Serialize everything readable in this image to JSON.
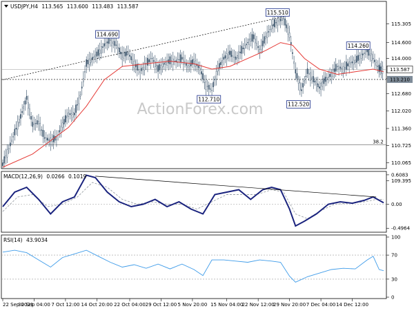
{
  "chart_data": {
    "type": "line",
    "symbol_header": "USDJPY,H4",
    "ohlc": [
      "113.565",
      "113.600",
      "113.483",
      "113.587"
    ],
    "watermark": "ActionForex.com",
    "price_axis": {
      "range": [
        109.9,
        116.1
      ],
      "ticks": [
        "115.305",
        "114.600",
        "114.000",
        "113.240",
        "112.680",
        "112.020",
        "111.360",
        "110.725",
        "110.065",
        "109.395"
      ]
    },
    "current_price": "113.587",
    "support_level": "113.210",
    "fib_label": "38.2",
    "fib_level": 110.75,
    "annotations": [
      {
        "label": "114.690",
        "x": 70,
        "y": 114.69
      },
      {
        "label": "115.510",
        "x": 184,
        "y": 115.51
      },
      {
        "label": "112.710",
        "x": 138,
        "y": 112.71
      },
      {
        "label": "112.520",
        "x": 198,
        "y": 112.52
      },
      {
        "label": "114.260",
        "x": 238,
        "y": 114.26
      }
    ],
    "price_series": [
      [
        0,
        110.0
      ],
      [
        4,
        110.6
      ],
      [
        8,
        111.2
      ],
      [
        12,
        111.8
      ],
      [
        16,
        112.5
      ],
      [
        20,
        111.5
      ],
      [
        24,
        111.6
      ],
      [
        28,
        111.0
      ],
      [
        32,
        110.9
      ],
      [
        36,
        111.0
      ],
      [
        40,
        111.5
      ],
      [
        44,
        111.9
      ],
      [
        48,
        111.9
      ],
      [
        52,
        112.6
      ],
      [
        56,
        113.8
      ],
      [
        60,
        114.0
      ],
      [
        64,
        114.2
      ],
      [
        68,
        114.5
      ],
      [
        72,
        114.7
      ],
      [
        76,
        114.5
      ],
      [
        80,
        114.1
      ],
      [
        84,
        114.2
      ],
      [
        88,
        113.8
      ],
      [
        92,
        113.5
      ],
      [
        96,
        113.8
      ],
      [
        100,
        114.0
      ],
      [
        104,
        113.6
      ],
      [
        108,
        113.8
      ],
      [
        112,
        113.9
      ],
      [
        116,
        113.9
      ],
      [
        120,
        114.0
      ],
      [
        124,
        113.7
      ],
      [
        128,
        113.9
      ],
      [
        132,
        113.6
      ],
      [
        136,
        113.0
      ],
      [
        140,
        112.8
      ],
      [
        144,
        113.6
      ],
      [
        148,
        114.0
      ],
      [
        152,
        114.2
      ],
      [
        156,
        114.0
      ],
      [
        160,
        114.3
      ],
      [
        164,
        114.6
      ],
      [
        168,
        114.8
      ],
      [
        172,
        114.3
      ],
      [
        176,
        114.8
      ],
      [
        180,
        115.2
      ],
      [
        184,
        115.4
      ],
      [
        188,
        115.5
      ],
      [
        192,
        114.9
      ],
      [
        196,
        113.5
      ],
      [
        200,
        112.8
      ],
      [
        204,
        113.5
      ],
      [
        208,
        113.2
      ],
      [
        212,
        112.9
      ],
      [
        216,
        113.2
      ],
      [
        220,
        113.4
      ],
      [
        224,
        113.7
      ],
      [
        228,
        113.6
      ],
      [
        232,
        113.8
      ],
      [
        236,
        113.9
      ],
      [
        240,
        114.1
      ],
      [
        244,
        114.3
      ],
      [
        248,
        114.0
      ],
      [
        252,
        113.6
      ],
      [
        255,
        113.59
      ]
    ],
    "ma_series": [
      [
        0,
        109.9
      ],
      [
        20,
        110.4
      ],
      [
        32,
        110.9
      ],
      [
        44,
        111.4
      ],
      [
        56,
        112.2
      ],
      [
        68,
        113.2
      ],
      [
        80,
        113.7
      ],
      [
        96,
        113.8
      ],
      [
        112,
        113.9
      ],
      [
        128,
        113.8
      ],
      [
        140,
        113.6
      ],
      [
        152,
        113.7
      ],
      [
        164,
        114.0
      ],
      [
        176,
        114.3
      ],
      [
        186,
        114.6
      ],
      [
        194,
        114.5
      ],
      [
        202,
        114.0
      ],
      [
        212,
        113.6
      ],
      [
        224,
        113.4
      ],
      [
        236,
        113.5
      ],
      [
        248,
        113.6
      ],
      [
        255,
        113.5
      ]
    ],
    "trendline_price": [
      [
        0,
        113.2
      ],
      [
        190,
        115.6
      ]
    ],
    "x_axis": {
      "max_bar": 255,
      "labels": [
        "22 Sep 2021",
        "30 Sep 04:00",
        "7 Oct 12:00",
        "14 Oct 20:00",
        "22 Oct 04:00",
        "29 Oct 12:00",
        "5 Nov 20:00",
        "15 Nov 04:00",
        "22 Nov 12:00",
        "29 Nov 20:00",
        "7 Dec 04:00",
        "14 Dec 12:00"
      ],
      "label_bars": [
        0,
        21,
        42,
        63,
        85,
        106,
        127,
        150,
        171,
        192,
        213,
        234
      ]
    },
    "macd": {
      "label": "MACD(12,26,9)",
      "values": [
        "0.0266",
        "0.1019"
      ],
      "range": [
        -0.55,
        0.65
      ],
      "ticks": [
        "0.6083",
        "0.00",
        "-0.4964"
      ],
      "macd_series": [
        [
          0,
          -0.05
        ],
        [
          8,
          0.25
        ],
        [
          16,
          0.35
        ],
        [
          24,
          0.1
        ],
        [
          32,
          -0.2
        ],
        [
          40,
          0.05
        ],
        [
          48,
          0.15
        ],
        [
          56,
          0.6
        ],
        [
          62,
          0.55
        ],
        [
          70,
          0.25
        ],
        [
          78,
          0.05
        ],
        [
          86,
          -0.05
        ],
        [
          94,
          0.0
        ],
        [
          102,
          0.1
        ],
        [
          110,
          -0.05
        ],
        [
          118,
          0.05
        ],
        [
          126,
          -0.1
        ],
        [
          134,
          -0.2
        ],
        [
          142,
          0.2
        ],
        [
          150,
          0.25
        ],
        [
          158,
          0.3
        ],
        [
          166,
          0.1
        ],
        [
          174,
          0.3
        ],
        [
          180,
          0.35
        ],
        [
          186,
          0.3
        ],
        [
          192,
          -0.1
        ],
        [
          196,
          -0.45
        ],
        [
          202,
          -0.35
        ],
        [
          210,
          -0.2
        ],
        [
          218,
          0.0
        ],
        [
          226,
          0.05
        ],
        [
          234,
          0.02
        ],
        [
          242,
          0.08
        ],
        [
          248,
          0.15
        ],
        [
          255,
          0.03
        ]
      ],
      "signal_series": [
        [
          0,
          -0.15
        ],
        [
          10,
          0.15
        ],
        [
          20,
          0.2
        ],
        [
          30,
          -0.05
        ],
        [
          40,
          0.0
        ],
        [
          50,
          0.15
        ],
        [
          60,
          0.45
        ],
        [
          70,
          0.35
        ],
        [
          80,
          0.1
        ],
        [
          90,
          0.0
        ],
        [
          100,
          0.05
        ],
        [
          110,
          0.0
        ],
        [
          120,
          0.0
        ],
        [
          130,
          -0.1
        ],
        [
          140,
          0.05
        ],
        [
          150,
          0.2
        ],
        [
          160,
          0.2
        ],
        [
          170,
          0.2
        ],
        [
          180,
          0.3
        ],
        [
          188,
          0.25
        ],
        [
          196,
          -0.2
        ],
        [
          204,
          -0.3
        ],
        [
          212,
          -0.15
        ],
        [
          222,
          0.0
        ],
        [
          232,
          0.02
        ],
        [
          242,
          0.05
        ],
        [
          250,
          0.1
        ],
        [
          255,
          0.1
        ]
      ],
      "trendline": [
        [
          62,
          0.58
        ],
        [
          250,
          0.15
        ]
      ]
    },
    "rsi": {
      "label": "RSI(14)",
      "value": "43.9034",
      "range": [
        0,
        100
      ],
      "ticks": [
        "100",
        "70",
        "30",
        "0"
      ],
      "levels": [
        70,
        30
      ],
      "series": [
        [
          0,
          75
        ],
        [
          8,
          78
        ],
        [
          16,
          74
        ],
        [
          24,
          62
        ],
        [
          32,
          50
        ],
        [
          40,
          66
        ],
        [
          48,
          72
        ],
        [
          56,
          78
        ],
        [
          64,
          68
        ],
        [
          72,
          58
        ],
        [
          80,
          50
        ],
        [
          88,
          54
        ],
        [
          96,
          48
        ],
        [
          104,
          55
        ],
        [
          112,
          47
        ],
        [
          120,
          55
        ],
        [
          128,
          46
        ],
        [
          134,
          36
        ],
        [
          140,
          62
        ],
        [
          148,
          62
        ],
        [
          156,
          60
        ],
        [
          164,
          58
        ],
        [
          172,
          62
        ],
        [
          180,
          60
        ],
        [
          186,
          58
        ],
        [
          192,
          35
        ],
        [
          196,
          25
        ],
        [
          204,
          34
        ],
        [
          212,
          40
        ],
        [
          220,
          46
        ],
        [
          228,
          48
        ],
        [
          236,
          47
        ],
        [
          244,
          62
        ],
        [
          248,
          68
        ],
        [
          252,
          46
        ],
        [
          255,
          44
        ]
      ]
    }
  }
}
